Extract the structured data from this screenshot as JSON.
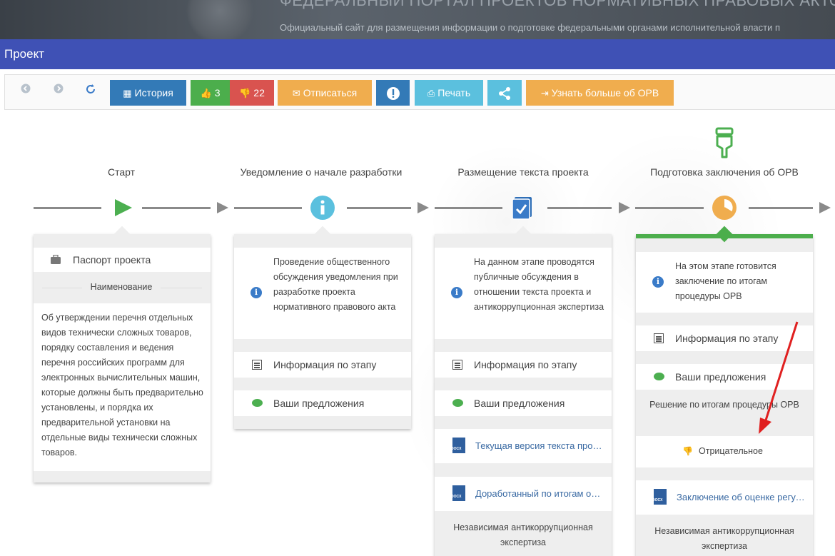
{
  "banner": {
    "title": "ФЕДЕРАЛЬНЫЙ ПОРТАЛ ПРОЕКТОВ НОРМАТИВНЫХ ПРАВОВЫХ АКТОВ",
    "subtitle": "Официальный сайт для размещения информации о подготовке федеральными органами исполнительной власти п"
  },
  "page_title": "Проект",
  "toolbar": {
    "history": "История",
    "likes": "3",
    "dislikes": "22",
    "unsubscribe": "Отписаться",
    "print": "Печать",
    "learn_more": "Узнать больше об ОРВ"
  },
  "stages": [
    {
      "title": "Старт"
    },
    {
      "title": "Уведомление о начале разработки"
    },
    {
      "title": "Размещение текста проекта"
    },
    {
      "title": "Подготовка заключения об ОРВ"
    }
  ],
  "card1": {
    "passport": "Паспорт проекта",
    "name_header": "Наименование",
    "name_text": "Об утверждении перечня отдельных видов технически сложных товаров, порядку составления и ведения перечня российских программ для электронных вычислительных машин, которые должны быть предварительно установлены, и порядка их предварительной установки на отдельные виды технически сложных товаров."
  },
  "card2": {
    "info": "Проведение общественного обсуждения уведомления при разработке проекта нормативного правового акта",
    "stage_info": "Информация по этапу",
    "proposals": "Ваши предложения"
  },
  "card3": {
    "info": "На данном этапе проводятся публичные обсуждения в отношении текста проекта и антикоррупционная экспертиза",
    "stage_info": "Информация по этапу",
    "proposals": "Ваши предложения",
    "doc1": "Текущая версия текста проекта",
    "doc2": "Доработанный по итогам обсуждения",
    "section": "Независимая антикоррупционная экспертиза"
  },
  "card4": {
    "info": "На этом этапе готовится заключение по итогам процедуры ОРВ",
    "stage_info": "Информация по этапу",
    "proposals": "Ваши предложения",
    "decision_header": "Решение по итогам процедуры ОРВ",
    "decision": "Отрицательное",
    "doc": "Заключение об оценке регулирующего воздействия",
    "section": "Независимая антикоррупционная экспертиза"
  },
  "colors": {
    "title_bar": "#3f51b5",
    "primary": "#337ab7",
    "success": "#4cae4c",
    "danger": "#d9534f",
    "warning": "#f0ad4e",
    "info": "#5bc0de",
    "annotation_arrow": "#e02020"
  }
}
